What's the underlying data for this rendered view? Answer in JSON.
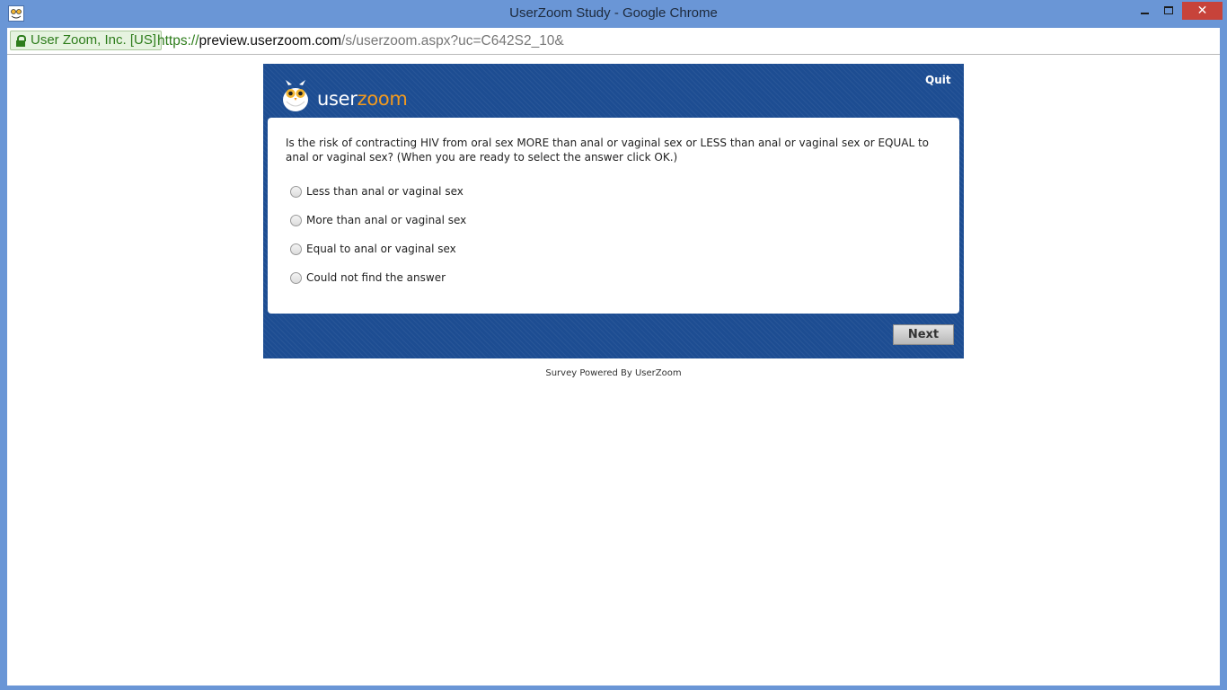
{
  "window": {
    "title": "UserZoom Study - Google Chrome",
    "close_glyph": "✕"
  },
  "address_bar": {
    "certificate": "User Zoom, Inc. [US]",
    "url_scheme": "https://",
    "url_host": "preview.userzoom.com",
    "url_path": "/s/userzoom.aspx?uc=C642S2_10&"
  },
  "survey": {
    "logo": {
      "part1": "user",
      "part2": "zoom"
    },
    "quit_label": "Quit",
    "question": "Is the risk of contracting HIV from oral sex MORE than anal or vaginal sex or LESS than anal or vaginal sex or EQUAL to anal or vaginal sex? (When you are ready to select the answer click OK.)",
    "options": [
      {
        "label": "Less than anal or vaginal sex",
        "selected": false
      },
      {
        "label": "More than anal or vaginal sex",
        "selected": false
      },
      {
        "label": "Equal to anal or vaginal sex",
        "selected": false
      },
      {
        "label": "Could not find the answer",
        "selected": false
      }
    ],
    "next_label": "Next",
    "footer": "Survey Powered By UserZoom"
  },
  "colors": {
    "window_frame": "#6a96d6",
    "survey_panel": "#1d4d92",
    "brand_orange": "#f29a1f",
    "secure_green": "#2e7d1c",
    "close_button": "#c7433a"
  }
}
